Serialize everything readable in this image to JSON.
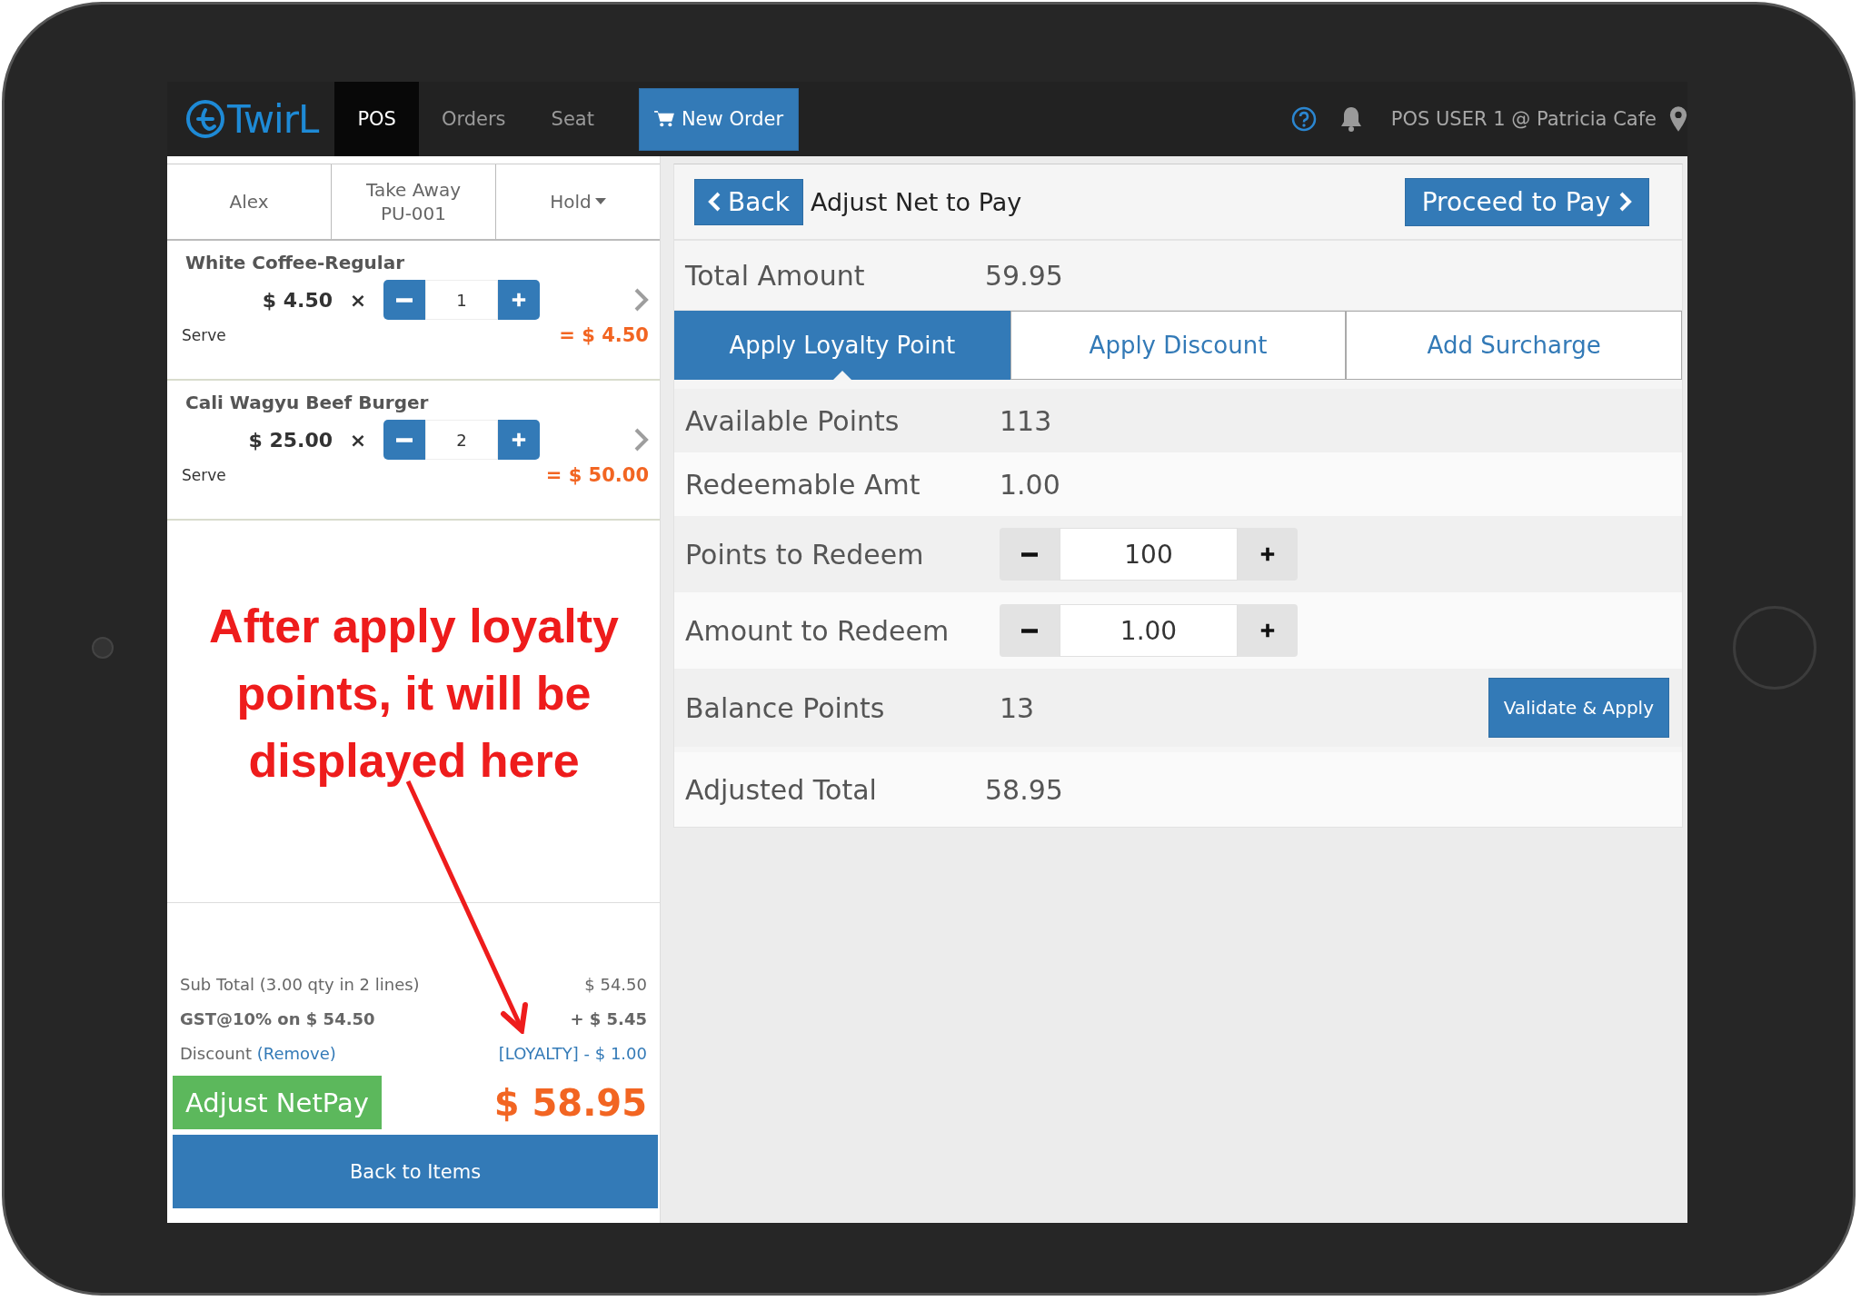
{
  "nav": {
    "logo": "TwirL",
    "tabs": [
      {
        "label": "POS",
        "selected": true
      },
      {
        "label": "Orders",
        "selected": false
      },
      {
        "label": "Seat",
        "selected": false
      }
    ],
    "new_order": "New Order",
    "user": "POS USER 1 @ Patricia Cafe"
  },
  "order": {
    "header": [
      {
        "lines": [
          "Alex"
        ],
        "dropdown": false
      },
      {
        "lines": [
          "Take Away",
          "PU-001"
        ],
        "dropdown": false
      },
      {
        "lines": [
          "Hold"
        ],
        "dropdown": true
      }
    ],
    "items": [
      {
        "name": "White Coffee-Regular",
        "price": "$ 4.50",
        "times": "×",
        "qty": "1",
        "note": "Serve",
        "total": "= $ 4.50"
      },
      {
        "name": "Cali Wagyu Beef Burger",
        "price": "$ 25.00",
        "times": "×",
        "qty": "2",
        "note": "Serve",
        "total": "= $ 50.00"
      }
    ],
    "subtotal": {
      "label": "Sub Total (3.00 qty in 2 lines)",
      "value": "$ 54.50"
    },
    "tax": {
      "label": "GST@10% on $ 54.50",
      "value": "+ $ 5.45"
    },
    "discount": {
      "label": "Discount",
      "link": "(Remove)",
      "value": "[LOYALTY] - $ 1.00"
    },
    "adjust_button": "Adjust NetPay",
    "net_total": "$ 58.95",
    "back_button": "Back to Items"
  },
  "annotation": {
    "text": "After apply loyalty points, it will be displayed here"
  },
  "adjust": {
    "back": "Back",
    "title": "Adjust Net to Pay",
    "proceed": "Proceed to Pay",
    "total_amount": {
      "label": "Total Amount",
      "value": "59.95"
    },
    "tabs": [
      {
        "label": "Apply Loyalty Point",
        "selected": true
      },
      {
        "label": "Apply Discount",
        "selected": false
      },
      {
        "label": "Add Surcharge",
        "selected": false
      }
    ],
    "rows": [
      {
        "kind": "info",
        "label": "Available Points",
        "value": "113"
      },
      {
        "kind": "info",
        "label": "Redeemable Amt",
        "value": "1.00"
      },
      {
        "kind": "stepper",
        "label": "Points to Redeem",
        "value": "100"
      },
      {
        "kind": "stepper",
        "label": "Amount to Redeem",
        "value": "1.00"
      },
      {
        "kind": "action",
        "label": "Balance Points",
        "value": "13",
        "button": "Validate & Apply"
      }
    ],
    "adjusted_total": {
      "label": "Adjusted Total",
      "value": "58.95"
    }
  }
}
